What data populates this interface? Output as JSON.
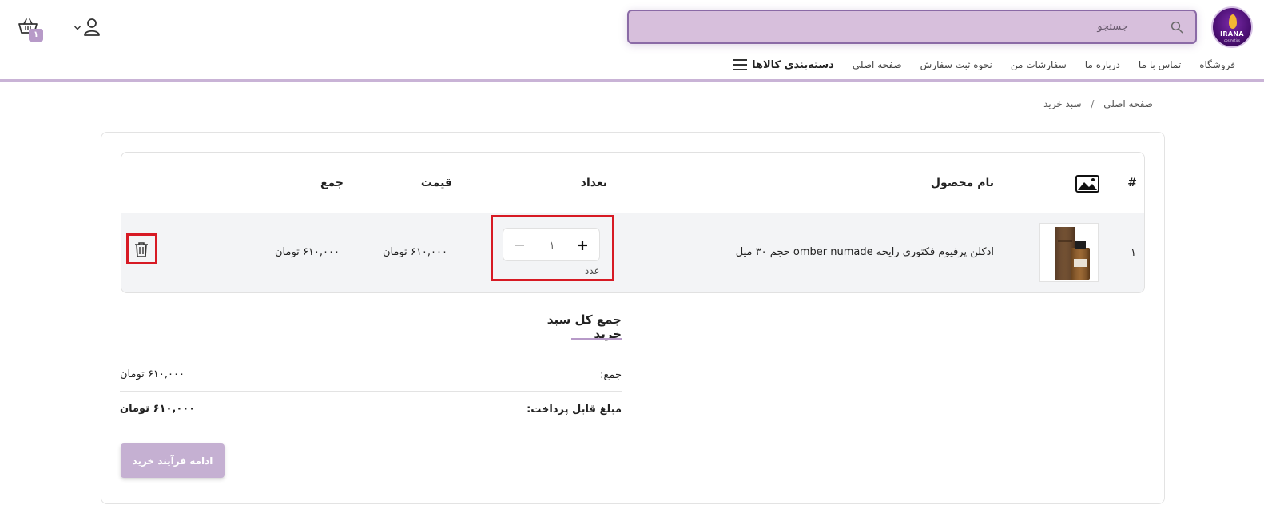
{
  "header": {
    "logo_text": "IRANA",
    "logo_sub": "cosmetics",
    "search_placeholder": "جستجو",
    "cart_count": "۱",
    "colors": {
      "accent": "#b79ac8",
      "search_bg": "#d7bfdc",
      "highlight": "#d71a24"
    }
  },
  "nav": {
    "categories_label": "دسته‌بندی کالاها",
    "links": [
      "صفحه اصلی",
      "نحوه ثبت سفارش",
      "سفارشات من",
      "درباره ما",
      "تماس با ما",
      "فروشگاه"
    ]
  },
  "breadcrumb": {
    "home": "صفحه اصلی",
    "separator": "/",
    "current": "سبد خرید"
  },
  "table": {
    "headers": {
      "index": "#",
      "product": "نام محصول",
      "quantity": "تعداد",
      "price": "قیمت",
      "total": "جمع"
    },
    "rows": [
      {
        "index": "۱",
        "name": "ادکلن پرفیوم فکتوری رایحه omber numade حجم ۳۰ میل",
        "quantity": "۱",
        "unit": "عدد",
        "price": "۶۱۰,۰۰۰ تومان",
        "total": "۶۱۰,۰۰۰ تومان"
      }
    ]
  },
  "totals": {
    "title": "جمع کل سبد خرید",
    "subtotal_label": "جمع:",
    "subtotal_value": "۶۱۰,۰۰۰ تومان",
    "payable_label": "مبلغ قابل پرداخت:",
    "payable_value": "۶۱۰,۰۰۰ تومان"
  },
  "checkout_label": "ادامه فرآیند خرید",
  "icons": [
    "search-icon",
    "user-icon",
    "chevron-down-icon",
    "cart-icon",
    "menu-icon",
    "image-icon",
    "plus-icon",
    "minus-icon",
    "trash-icon"
  ]
}
